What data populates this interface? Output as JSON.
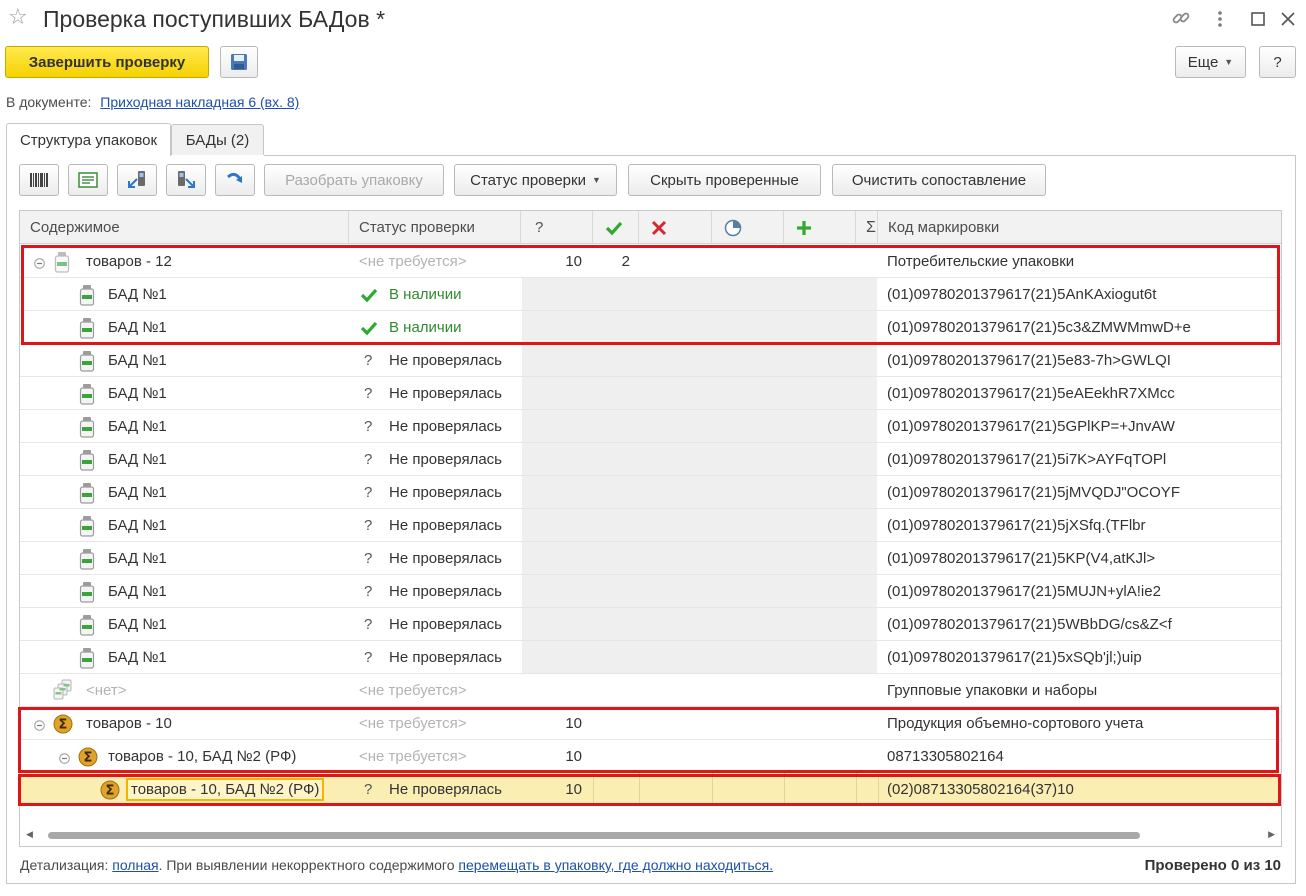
{
  "window": {
    "title": "Проверка поступивших БАДов *"
  },
  "toolbar": {
    "finish_label": "Завершить проверку",
    "more_label": "Еще",
    "help_label": "?"
  },
  "document": {
    "label": "В документе:",
    "link": "Приходная накладная 6 (вх. 8)"
  },
  "tabs": [
    {
      "label": "Структура упаковок",
      "active": true
    },
    {
      "label": "БАДы (2)",
      "active": false
    }
  ],
  "grid_toolbar": {
    "unpack_label": "Разобрать упаковку",
    "status_label": "Статус проверки",
    "hide_checked_label": "Скрыть проверенные",
    "clear_label": "Очистить сопоставление"
  },
  "columns": {
    "content": "Содержимое",
    "status": "Статус проверки",
    "unknown": "?",
    "code": "Код маркировки"
  },
  "rows": [
    {
      "name": "товаров - 12",
      "status": "<не требуется>",
      "q": "10",
      "ok": "2",
      "code": "Потребительские упаковки"
    },
    {
      "name": "БАД №1",
      "status": "В наличии",
      "code": "(01)09780201379617(21)5AnKAxiogut6t"
    },
    {
      "name": "БАД №1",
      "status": "В наличии",
      "code": "(01)09780201379617(21)5c3&ZMWMmwD+e"
    },
    {
      "name": "БАД №1",
      "status_mark": "?",
      "status": "Не проверялась",
      "code": "(01)09780201379617(21)5e83-7h>GWLQI"
    },
    {
      "name": "БАД №1",
      "status_mark": "?",
      "status": "Не проверялась",
      "code": "(01)09780201379617(21)5eAEekhR7XMcc"
    },
    {
      "name": "БАД №1",
      "status_mark": "?",
      "status": "Не проверялась",
      "code": "(01)09780201379617(21)5GPlKP=+JnvAW"
    },
    {
      "name": "БАД №1",
      "status_mark": "?",
      "status": "Не проверялась",
      "code": "(01)09780201379617(21)5i7K>AYFqTOPl"
    },
    {
      "name": "БАД №1",
      "status_mark": "?",
      "status": "Не проверялась",
      "code": "(01)09780201379617(21)5jMVQDJ\"OCOYF"
    },
    {
      "name": "БАД №1",
      "status_mark": "?",
      "status": "Не проверялась",
      "code": "(01)09780201379617(21)5jXSfq.(TFlbr"
    },
    {
      "name": "БАД №1",
      "status_mark": "?",
      "status": "Не проверялась",
      "code": "(01)09780201379617(21)5KP(V4,atKJl>"
    },
    {
      "name": "БАД №1",
      "status_mark": "?",
      "status": "Не проверялась",
      "code": "(01)09780201379617(21)5MUJN+ylA!ie2"
    },
    {
      "name": "БАД №1",
      "status_mark": "?",
      "status": "Не проверялась",
      "code": "(01)09780201379617(21)5WBbDG/cs&Z<f"
    },
    {
      "name": "БАД №1",
      "status_mark": "?",
      "status": "Не проверялась",
      "code": "(01)09780201379617(21)5xSQb'jl;)uip"
    },
    {
      "name": "<нет>",
      "status": "<не требуется>",
      "code": "Групповые упаковки и наборы"
    },
    {
      "name": "товаров - 10",
      "status": "<не требуется>",
      "q": "10",
      "code": "Продукция объемно-сортового учета"
    },
    {
      "name": "товаров - 10, БАД №2 (РФ)",
      "status": "<не требуется>",
      "q": "10",
      "code": "08713305802164"
    },
    {
      "name": "товаров - 10, БАД №2 (РФ)",
      "status_mark": "?",
      "status": "Не проверялась",
      "q": "10",
      "code": "(02)08713305802164(37)10"
    }
  ],
  "footer": {
    "detail_label": "Детализация:",
    "detail_link": "полная",
    "middle_text": ". При выявлении некорректного содержимого",
    "move_link": "перемещать в упаковку, где должно находиться.",
    "checked_text": "Проверено 0 из 10"
  },
  "colors": {
    "primary_button": "#f5d200",
    "selection": "#fbeeb3",
    "highlight_box": "#e0141b",
    "ok_green": "#2f8b2f",
    "cancel_red": "#d9262c",
    "link": "#1f4fa8"
  }
}
